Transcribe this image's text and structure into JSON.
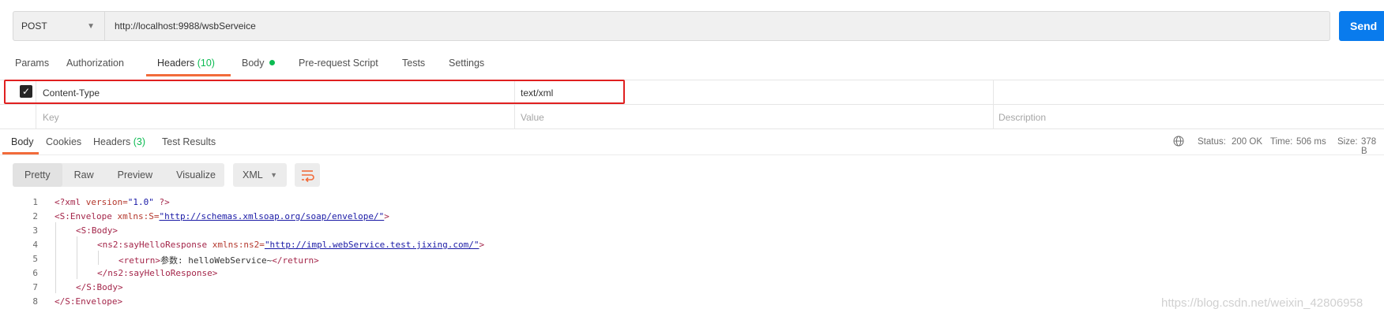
{
  "request": {
    "method": "POST",
    "url": "http://localhost:9988/wsbServeice",
    "send_label": "Send"
  },
  "request_tabs": {
    "params": "Params",
    "authorization": "Authorization",
    "headers": "Headers",
    "headers_count": "(10)",
    "body": "Body",
    "pre_request": "Pre-request Script",
    "tests": "Tests",
    "settings": "Settings"
  },
  "headers_table": {
    "row": {
      "key": "Content-Type",
      "value": "text/xml",
      "checked": true
    },
    "placeholders": {
      "key": "Key",
      "value": "Value",
      "description": "Description"
    }
  },
  "response_tabs": {
    "body": "Body",
    "cookies": "Cookies",
    "headers": "Headers",
    "headers_count": "(3)",
    "test_results": "Test Results"
  },
  "status": {
    "status_label": "Status:",
    "status_value": "200 OK",
    "time_label": "Time:",
    "time_value": "506 ms",
    "size_label": "Size:",
    "size_value": "378 B"
  },
  "format_toolbar": {
    "pretty": "Pretty",
    "raw": "Raw",
    "preview": "Preview",
    "visualize": "Visualize",
    "language": "XML"
  },
  "code": {
    "line_numbers": [
      "1",
      "2",
      "3",
      "4",
      "5",
      "6",
      "7",
      "8"
    ],
    "l1_open": "<?xml",
    "l1_attr": " version=",
    "l1_val": "\"1.0\"",
    "l1_close": " ?>",
    "l2_open": "<S:Envelope",
    "l2_attr": " xmlns:S=",
    "l2_val": "\"http://schemas.xmlsoap.org/soap/envelope/\"",
    "l2_close": ">",
    "l3": "<S:Body>",
    "l4_open": "<ns2:sayHelloResponse",
    "l4_attr": " xmlns:ns2=",
    "l4_val": "\"http://impl.webService.test.jixing.com/\"",
    "l4_close": ">",
    "l5_open": "<return>",
    "l5_text": "参数: helloWebService~",
    "l5_close": "</return>",
    "l6": "</ns2:sayHelloResponse>",
    "l7": "</S:Body>",
    "l8": "</S:Envelope>"
  },
  "watermark": "https://blog.csdn.net/weixin_42806958",
  "colors": {
    "accent": "#f26b3a",
    "send": "#097bed",
    "success": "#0cbb52",
    "highlight": "#e02020"
  }
}
